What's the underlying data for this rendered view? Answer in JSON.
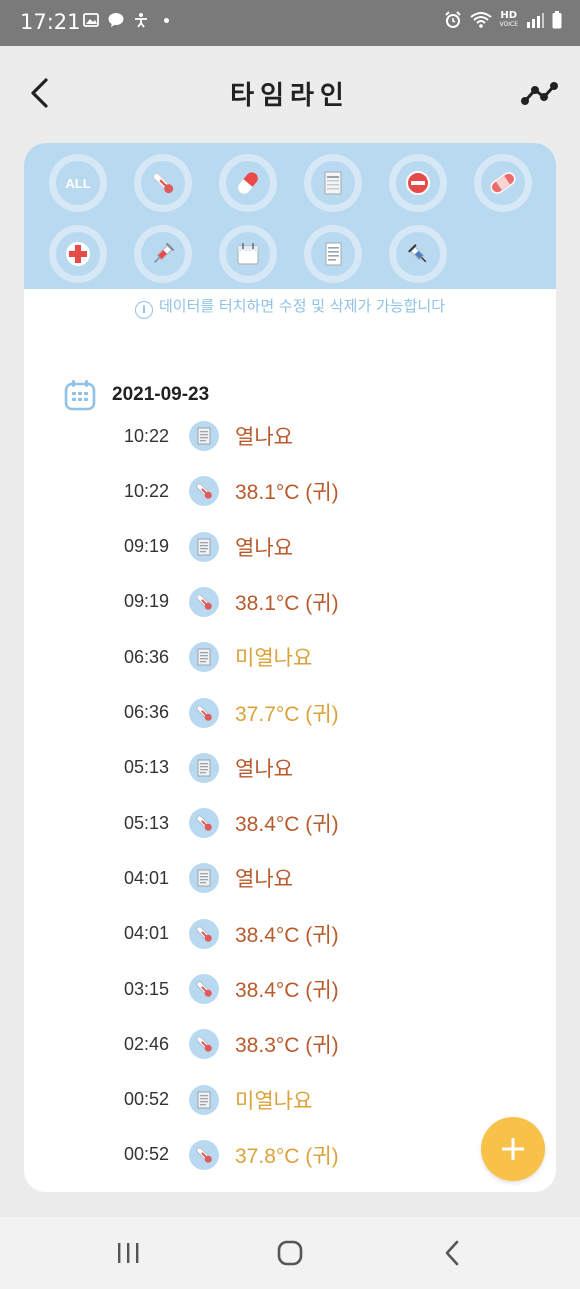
{
  "status_bar": {
    "time": "17:21",
    "network": "HD",
    "network_sub": "VOICE"
  },
  "header": {
    "title": "타임라인"
  },
  "filters": [
    {
      "name": "all",
      "label": "ALL",
      "icon": "all-icon"
    },
    {
      "name": "temperature",
      "icon": "thermometer-icon"
    },
    {
      "name": "medicine",
      "icon": "pill-icon"
    },
    {
      "name": "note",
      "icon": "document-icon"
    },
    {
      "name": "stop",
      "icon": "no-entry-icon"
    },
    {
      "name": "bandage",
      "icon": "bandage-icon"
    },
    {
      "name": "hospital",
      "icon": "medical-cross-icon"
    },
    {
      "name": "vaccine",
      "icon": "syringe-icon"
    },
    {
      "name": "calendar",
      "icon": "calendar-icon"
    },
    {
      "name": "memo",
      "icon": "memo-icon"
    },
    {
      "name": "injection",
      "icon": "injection-icon"
    }
  ],
  "hint": "데이터를 터치하면 수정 및 삭제가 가능합니다",
  "timeline": {
    "date": "2021-09-23",
    "entries": [
      {
        "time": "10:22",
        "type": "note",
        "value": "열나요",
        "level": "high"
      },
      {
        "time": "10:22",
        "type": "temperature",
        "value": "38.1°C (귀)",
        "level": "high"
      },
      {
        "time": "09:19",
        "type": "note",
        "value": "열나요",
        "level": "high"
      },
      {
        "time": "09:19",
        "type": "temperature",
        "value": "38.1°C (귀)",
        "level": "high"
      },
      {
        "time": "06:36",
        "type": "note",
        "value": "미열나요",
        "level": "mild"
      },
      {
        "time": "06:36",
        "type": "temperature",
        "value": "37.7°C (귀)",
        "level": "mild"
      },
      {
        "time": "05:13",
        "type": "note",
        "value": "열나요",
        "level": "high"
      },
      {
        "time": "05:13",
        "type": "temperature",
        "value": "38.4°C (귀)",
        "level": "high"
      },
      {
        "time": "04:01",
        "type": "note",
        "value": "열나요",
        "level": "high"
      },
      {
        "time": "04:01",
        "type": "temperature",
        "value": "38.4°C (귀)",
        "level": "high"
      },
      {
        "time": "03:15",
        "type": "temperature",
        "value": "38.4°C (귀)",
        "level": "high"
      },
      {
        "time": "02:46",
        "type": "temperature",
        "value": "38.3°C (귀)",
        "level": "high"
      },
      {
        "time": "00:52",
        "type": "note",
        "value": "미열나요",
        "level": "mild"
      },
      {
        "time": "00:52",
        "type": "temperature",
        "value": "37.8°C (귀)",
        "level": "mild"
      }
    ]
  },
  "colors": {
    "high": "#b85a2c",
    "mild": "#dba23a",
    "panel": "#b9d9f1",
    "hint": "#8ec2e6",
    "fab": "#f8c24a",
    "status_bar": "#7a7a7a"
  }
}
